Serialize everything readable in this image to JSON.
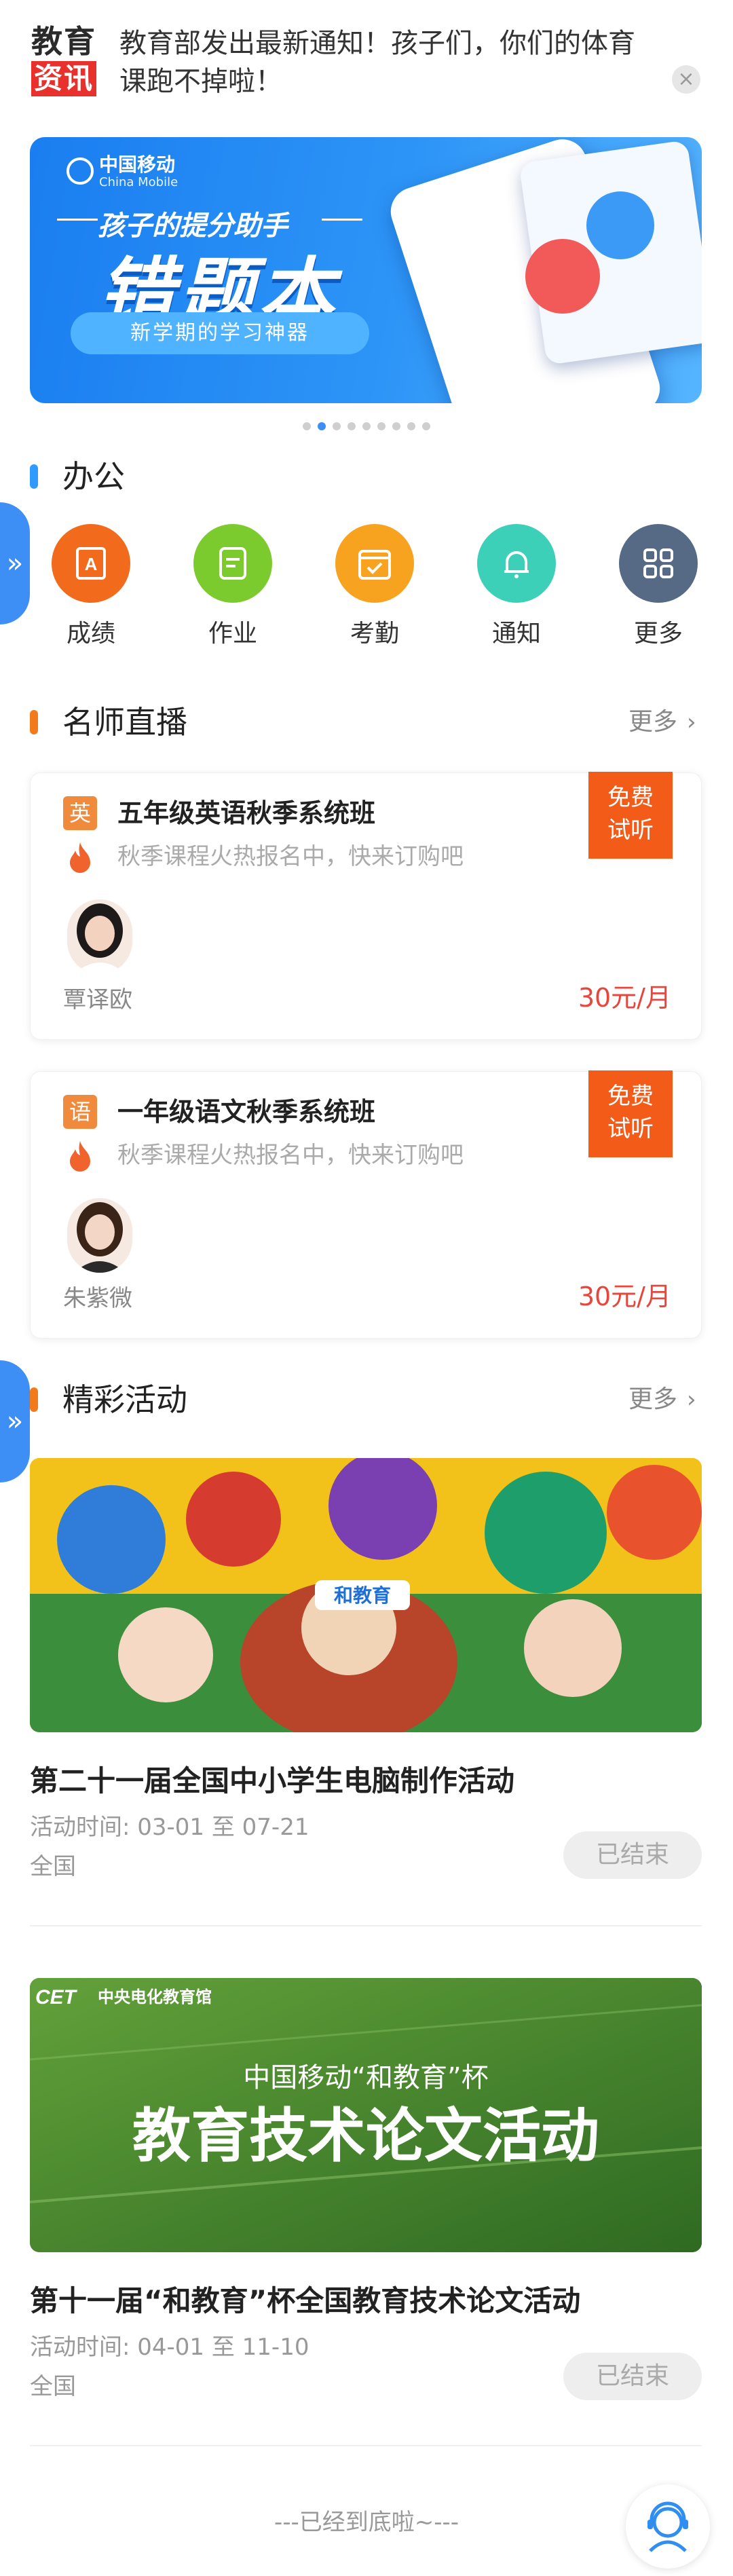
{
  "news": {
    "logo_line1": "教育",
    "logo_line2": "资讯",
    "text": "教育部发出最新通知！孩子们，你们的体育课跑不掉啦！",
    "close_icon": "close-icon"
  },
  "banner": {
    "brand_cn": "中国移动",
    "brand_en": "China Mobile",
    "slogan": "孩子的提分助手",
    "title": "错题本",
    "pill": "新学期的学习神器",
    "dots_total": 9,
    "dots_active": 1
  },
  "office": {
    "title": "办公",
    "bar_color": "#2f9bff",
    "items": [
      {
        "label": "成绩",
        "icon": "grade-icon",
        "color": "#f26a1b"
      },
      {
        "label": "作业",
        "icon": "homework-icon",
        "color": "#7ccb2e"
      },
      {
        "label": "考勤",
        "icon": "attendance-icon",
        "color": "#f7a320"
      },
      {
        "label": "通知",
        "icon": "bell-icon",
        "color": "#3dd0b8"
      },
      {
        "label": "更多",
        "icon": "more-grid-icon",
        "color": "#566a86"
      }
    ]
  },
  "live": {
    "title": "名师直播",
    "more": "更多",
    "bar_color": "#f27a1a",
    "courses": [
      {
        "subject": "英",
        "title": "五年级英语秋季系统班",
        "subtitle": "秋季课程火热报名中，快来订购吧",
        "teacher": "覃译欧",
        "price": "30元/月",
        "tag_line1": "免费",
        "tag_line2": "试听"
      },
      {
        "subject": "语",
        "title": "一年级语文秋季系统班",
        "subtitle": "秋季课程火热报名中，快来订购吧",
        "teacher": "朱紫微",
        "price": "30元/月",
        "tag_line1": "免费",
        "tag_line2": "试听"
      }
    ]
  },
  "activities": {
    "title": "精彩活动",
    "more": "更多",
    "bar_color": "#f27a1a",
    "items": [
      {
        "title": "第二十一届全国中小学生电脑制作活动",
        "time": "活动时间: 03-01 至 07-21",
        "region": "全国",
        "status": "已结束",
        "image_text": "和教育"
      },
      {
        "title": "第十一届“和教育”杯全国教育技术论文活动",
        "time": "活动时间: 04-01 至 11-10",
        "region": "全国",
        "status": "已结束",
        "image_org": "中央电化教育馆",
        "image_brand": "CET",
        "image_sub": "中国移动“和教育”杯",
        "image_main": "教育技术论文活动"
      }
    ]
  },
  "footer": {
    "end_text": "---已经到底啦~---",
    "service_icon": "customer-service-icon"
  },
  "side_tab": {
    "icon": "double-chevron-right-icon",
    "glyph": "»"
  }
}
